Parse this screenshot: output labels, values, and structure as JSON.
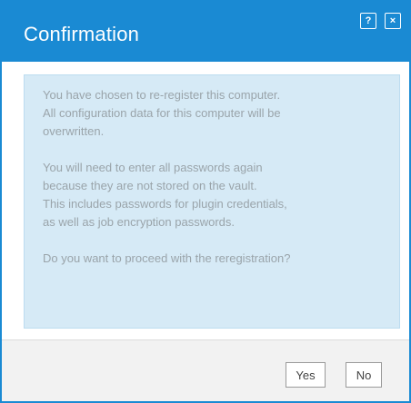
{
  "dialog": {
    "title": "Confirmation",
    "help_label": "?",
    "close_label": "×"
  },
  "message": {
    "paragraph1": [
      "You have chosen to re-register this computer.",
      "All configuration data for this computer will be",
      "overwritten."
    ],
    "paragraph2": [
      "You will need to enter all passwords again",
      "because they are not stored on the vault.",
      "This includes passwords for plugin credentials,",
      "as well as job encryption passwords."
    ],
    "paragraph3": [
      "Do you want to proceed with the reregistration?"
    ]
  },
  "buttons": {
    "yes_label": "Yes",
    "no_label": "No"
  },
  "colors": {
    "titlebar": "#1a8ad3",
    "message_bg": "#d6eaf6",
    "message_text": "#9aa4aa",
    "footer_bg": "#f2f2f2"
  }
}
